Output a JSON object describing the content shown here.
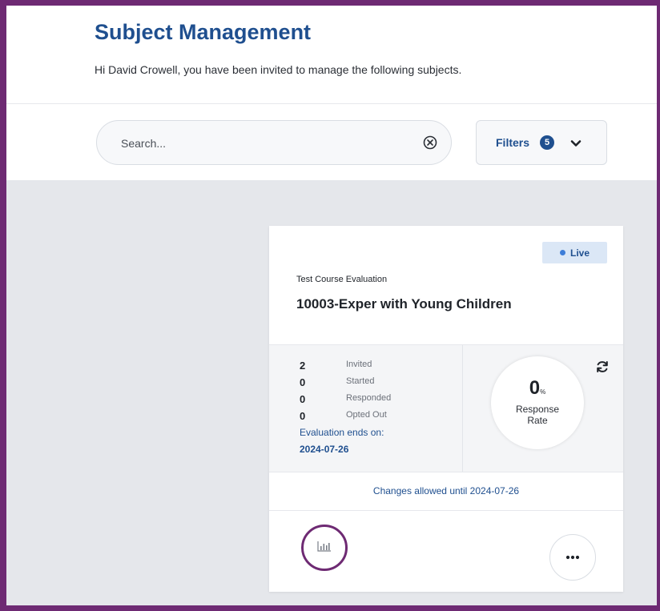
{
  "header": {
    "title": "Subject Management",
    "subtitle": "Hi David Crowell, you have been invited to manage the following subjects."
  },
  "toolbar": {
    "search_placeholder": "Search...",
    "filters_label": "Filters",
    "filters_count": "5"
  },
  "card": {
    "status": "Live",
    "evaluation_type": "Test Course Evaluation",
    "course_name": "10003-Exper with Young Children",
    "stats": [
      {
        "value": "2",
        "label": "Invited"
      },
      {
        "value": "0",
        "label": "Started"
      },
      {
        "value": "0",
        "label": "Responded"
      },
      {
        "value": "0",
        "label": "Opted Out"
      }
    ],
    "ends_label": "Evaluation ends on:",
    "ends_date": "2024-07-26",
    "response_rate_value": "0",
    "response_rate_unit": "%",
    "response_rate_label_line1": "Response",
    "response_rate_label_line2": "Rate",
    "changes_text": "Changes allowed until 2024-07-26"
  },
  "colors": {
    "brand_blue": "#1f4f8f",
    "highlight_purple": "#6e2a73",
    "live_badge_bg": "#dbe7f6"
  },
  "icons": {
    "search_clear": "clear-circle-x-icon",
    "filters_dropdown": "chevron-down-icon",
    "refresh": "refresh-icon",
    "report": "bar-chart-icon",
    "more": "more-horizontal-icon"
  }
}
